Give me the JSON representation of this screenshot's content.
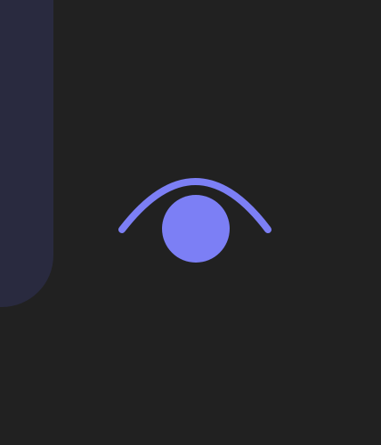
{
  "colors": {
    "background": "#212121",
    "side_panel": "#292a3f",
    "accent": "#7c7ff5"
  },
  "icons": {
    "main": "eye-icon"
  }
}
